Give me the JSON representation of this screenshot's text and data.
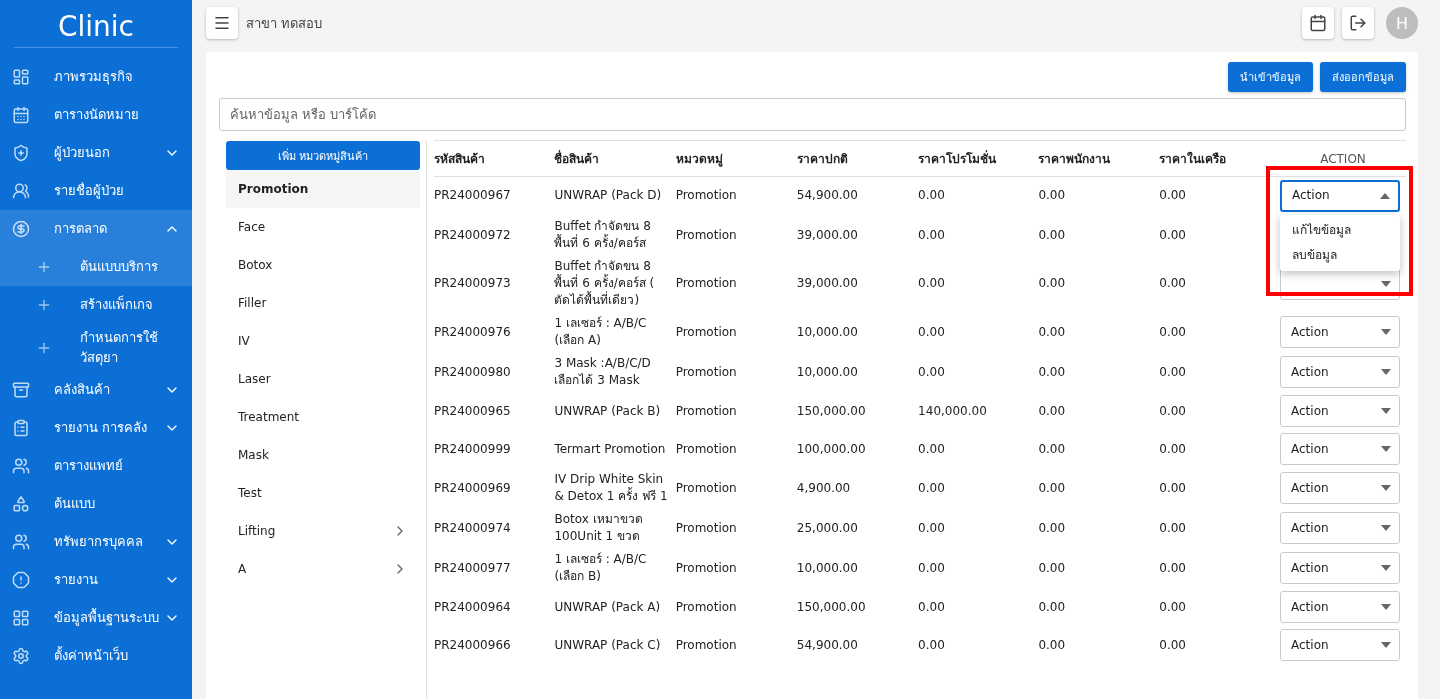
{
  "sidebar": {
    "logo": "Clinic",
    "items": [
      {
        "label": "ภาพรวมธุรกิจ",
        "selected": false
      },
      {
        "label": "ตารางนัดหมาย",
        "selected": false
      },
      {
        "label": "ผู้ป่วยนอก",
        "selected": false,
        "expanded": false
      },
      {
        "label": "รายชื่อผู้ป่วย",
        "selected": false
      },
      {
        "label": "การตลาด",
        "selected": true,
        "expanded": true,
        "children": [
          {
            "label": "ต้นแบบบริการ",
            "selected": true
          },
          {
            "label": "สร้างแพ็กเกจ",
            "selected": false
          },
          {
            "label": "กำหนดการใช้วัสดุยา",
            "selected": false
          }
        ]
      },
      {
        "label": "คลังสินค้า",
        "selected": false,
        "expanded": false
      },
      {
        "label": "รายงาน การคลัง",
        "selected": false,
        "expanded": false
      },
      {
        "label": "ตารางแพทย์",
        "selected": false
      },
      {
        "label": "ต้นแบบ",
        "selected": false
      },
      {
        "label": "ทรัพยากรบุคคล",
        "selected": false,
        "expanded": false
      },
      {
        "label": "รายงาน",
        "selected": false,
        "expanded": false
      },
      {
        "label": "ข้อมูลพื้นฐานระบบ",
        "selected": false,
        "expanded": false
      },
      {
        "label": "ตั้งค่าหน้าเว็บ",
        "selected": false
      }
    ]
  },
  "topbar": {
    "branch": "สาขา ทดสอบ",
    "avatar": "H"
  },
  "buttons": [
    "นำเข้าข้อมูล",
    "ส่งออกข้อมูล"
  ],
  "search": {
    "placeholder": "ค้นหาข้อมูล หรือ บาร์โค้ด"
  },
  "categories": {
    "add_button": "เพิ่ม หมวดหมู่สินค้า",
    "items": [
      {
        "label": "Promotion",
        "selected": true,
        "has_children": false
      },
      {
        "label": "Face",
        "selected": false,
        "has_children": false
      },
      {
        "label": "Botox",
        "selected": false,
        "has_children": false
      },
      {
        "label": "Filler",
        "selected": false,
        "has_children": false
      },
      {
        "label": "IV",
        "selected": false,
        "has_children": false
      },
      {
        "label": "Laser",
        "selected": false,
        "has_children": false
      },
      {
        "label": "Treatment",
        "selected": false,
        "has_children": false
      },
      {
        "label": "Mask",
        "selected": false,
        "has_children": false
      },
      {
        "label": "Test",
        "selected": false,
        "has_children": false
      },
      {
        "label": "Lifting",
        "selected": false,
        "has_children": true
      },
      {
        "label": "A",
        "selected": false,
        "has_children": true
      }
    ]
  },
  "table": {
    "columns": [
      "รหัสสินค้า",
      "ชื่อสินค้า",
      "หมวดหมู่",
      "ราคาปกติ",
      "ราคาโปรโมชั่น",
      "ราคาพนักงาน",
      "ราคาในเครือ",
      "ACTION"
    ],
    "rows": [
      {
        "cells": [
          "PR24000967",
          "UNWRAP (Pack D)",
          "Promotion",
          "54,900.00",
          "0.00",
          "0.00",
          "0.00"
        ],
        "action": "Action",
        "open": true,
        "highlighted": true,
        "menu": [
          "แก้ไขข้อมูล",
          "ลบข้อมูล"
        ]
      },
      {
        "cells": [
          "PR24000972",
          "Buffet กำจัดขน 8 พื้นที่ 6 ครั้ง/คอร์ส",
          "Promotion",
          "39,000.00",
          "0.00",
          "0.00",
          "0.00"
        ]
      },
      {
        "cells": [
          "PR24000973",
          "Buffet กำจัดขน 8 พื้นที่ 6 ครั้ง/คอร์ส ( ตัดได้พื้นที่เดียว)",
          "Promotion",
          "39,000.00",
          "0.00",
          "0.00",
          "0.00"
        ],
        "open": false
      },
      {
        "cells": [
          "PR24000976",
          "1 เลเซอร์ : A/B/C (เลือก A)",
          "Promotion",
          "10,000.00",
          "0.00",
          "0.00",
          "0.00"
        ],
        "action": "Action",
        "open": false
      },
      {
        "cells": [
          "PR24000980",
          "3 Mask :A/B/C/D เลือกได้ 3 Mask",
          "Promotion",
          "10,000.00",
          "0.00",
          "0.00",
          "0.00"
        ],
        "action": "Action",
        "open": false
      },
      {
        "cells": [
          "PR24000965",
          "UNWRAP (Pack B)",
          "Promotion",
          "150,000.00",
          "140,000.00",
          "0.00",
          "0.00"
        ],
        "action": "Action",
        "open": false
      },
      {
        "cells": [
          "PR24000999",
          "Termart Promotion",
          "Promotion",
          "100,000.00",
          "0.00",
          "0.00",
          "0.00"
        ],
        "action": "Action",
        "open": false
      },
      {
        "cells": [
          "PR24000969",
          "IV Drip White Skin & Detox 1 ครั้ง ฟรี 1",
          "Promotion",
          "4,900.00",
          "0.00",
          "0.00",
          "0.00"
        ],
        "action": "Action",
        "open": false
      },
      {
        "cells": [
          "PR24000974",
          "Botox เหมาขวด 100Unit 1 ขวด",
          "Promotion",
          "25,000.00",
          "0.00",
          "0.00",
          "0.00"
        ],
        "action": "Action",
        "open": false
      },
      {
        "cells": [
          "PR24000977",
          "1 เลเซอร์ : A/B/C (เลือก B)",
          "Promotion",
          "10,000.00",
          "0.00",
          "0.00",
          "0.00"
        ],
        "action": "Action",
        "open": false
      },
      {
        "cells": [
          "PR24000964",
          "UNWRAP (Pack A)",
          "Promotion",
          "150,000.00",
          "0.00",
          "0.00",
          "0.00"
        ],
        "action": "Action",
        "open": false
      },
      {
        "cells": [
          "PR24000966",
          "UNWRAP (Pack C)",
          "Promotion",
          "54,900.00",
          "0.00",
          "0.00",
          "0.00"
        ],
        "action": "Action",
        "open": false
      }
    ]
  }
}
